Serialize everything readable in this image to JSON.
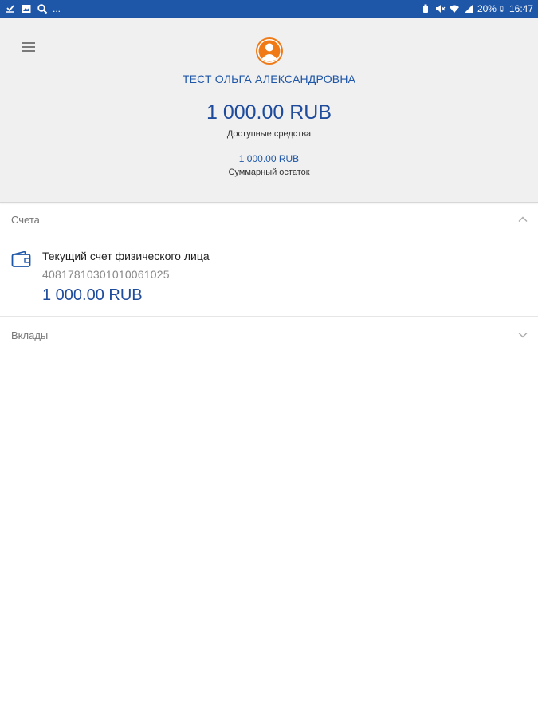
{
  "status_bar": {
    "left_icons": [
      "check-icon",
      "image-icon",
      "search-icon"
    ],
    "left_more": "...",
    "battery_percent": "20%",
    "time": "16:47"
  },
  "colors": {
    "status_bar": "#1e56a8",
    "accent_blue": "#1e4b9c",
    "avatar_orange": "#f07a16",
    "header_bg": "#f0f0f0"
  },
  "profile": {
    "name": "ТЕСТ ОЛЬГА АЛЕКСАНДРОВНА",
    "available_amount": "1 000.00 RUB",
    "available_label": "Доступные средства",
    "total_amount": "1 000.00 RUB",
    "total_label": "Суммарный остаток"
  },
  "sections": {
    "accounts": {
      "title": "Счета",
      "expanded": true,
      "items": [
        {
          "name": "Текущий счет физического лица",
          "number": "40817810301010061025",
          "amount": "1 000.00 RUB"
        }
      ]
    },
    "deposits": {
      "title": "Вклады",
      "expanded": false
    }
  }
}
